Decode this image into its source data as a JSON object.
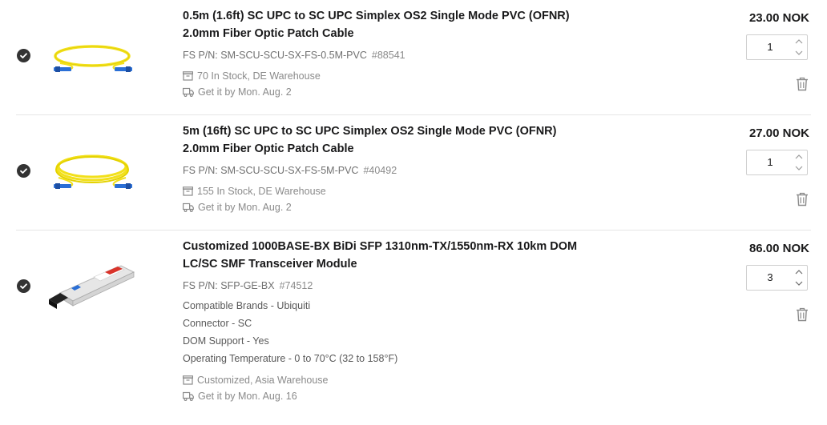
{
  "items": [
    {
      "title": "0.5m (1.6ft) SC UPC to SC UPC Simplex OS2 Single Mode PVC (OFNR) 2.0mm Fiber Optic Patch Cable",
      "pn_label": "FS P/N: SM-SCU-SCU-SX-FS-0.5M-PVC",
      "id": "#88541",
      "stock": "70 In Stock, DE Warehouse",
      "delivery": "Get it by Mon. Aug. 2",
      "price": "23.00 NOK",
      "qty": "1",
      "image": "yellow-fiber-patch-cable-image"
    },
    {
      "title": "5m (16ft) SC UPC to SC UPC Simplex OS2 Single Mode PVC (OFNR) 2.0mm Fiber Optic Patch Cable",
      "pn_label": "FS P/N: SM-SCU-SCU-SX-FS-5M-PVC",
      "id": "#40492",
      "stock": "155 In Stock, DE Warehouse",
      "delivery": "Get it by Mon. Aug. 2",
      "price": "27.00 NOK",
      "qty": "1",
      "image": "yellow-fiber-patch-cable-image"
    },
    {
      "title": "Customized 1000BASE-BX BiDi SFP 1310nm-TX/1550nm-RX 10km DOM LC/SC SMF Transceiver Module",
      "pn_label": "FS P/N: SFP-GE-BX",
      "id": "#74512",
      "attributes": [
        "Compatible Brands - Ubiquiti",
        "Connector - SC",
        "DOM Support - Yes",
        "Operating Temperature - 0 to 70°C (32 to 158°F)"
      ],
      "stock": "Customized, Asia Warehouse",
      "delivery": "Get it by Mon. Aug. 16",
      "price": "86.00 NOK",
      "qty": "3",
      "image": "sfp-transceiver-module-image"
    }
  ],
  "icons": {
    "select": "check-circle-icon",
    "stock": "warehouse-box-icon",
    "delivery": "truck-icon",
    "delete": "trash-icon",
    "increment": "chevron-up-icon",
    "decrement": "chevron-down-icon"
  },
  "colors": {
    "text": "#19191a",
    "muted": "#8a8a8a",
    "check": "#333333",
    "cable": "#f2e01a",
    "connector": "#2a6fd6"
  }
}
